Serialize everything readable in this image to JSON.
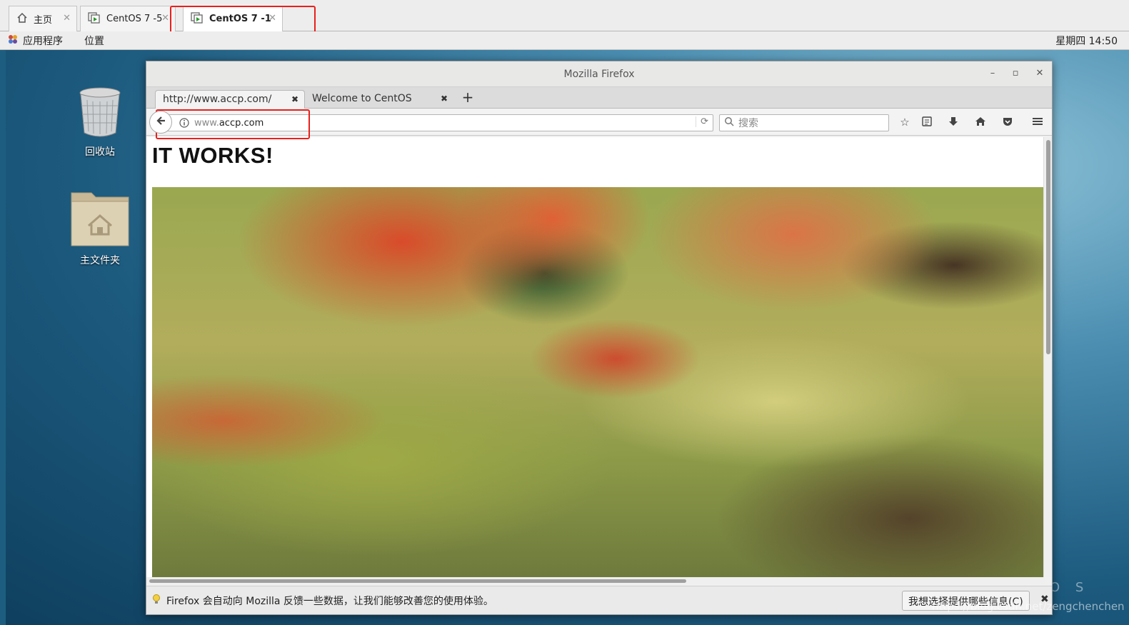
{
  "vm_tabs": [
    {
      "label": "主页",
      "active": false
    },
    {
      "label": "CentOS 7 -5",
      "active": false
    },
    {
      "label": "CentOS 7 -1",
      "active": true
    }
  ],
  "gnome_bar": {
    "applications": "应用程序",
    "places": "位置",
    "clock": "星期四 14:50"
  },
  "desktop_icons": [
    {
      "label": "回收站",
      "icon": "trash-icon"
    },
    {
      "label": "主文件夹",
      "icon": "home-folder-icon"
    }
  ],
  "firefox": {
    "window_title": "Mozilla Firefox",
    "tabs": [
      {
        "label": "http://www.accp.com/",
        "active": true
      },
      {
        "label": "Welcome to CentOS",
        "active": false
      }
    ],
    "url_prefix": "www.",
    "url_domain": "accp.com",
    "search_placeholder": "搜索",
    "page_heading": "IT WORKS!",
    "notification_text": "Firefox 会自动向 Mozilla 反馈一些数据，让我们能够改善您的使用体验。",
    "notification_button": "我想选择提供哪些信息(C)"
  },
  "watermark": "https://blog.csdn.net/zengchenchen",
  "desktop_brand": "O S",
  "colors": {
    "highlight_box": "#e8201c",
    "desktop_bg": "#1c5a7e"
  }
}
